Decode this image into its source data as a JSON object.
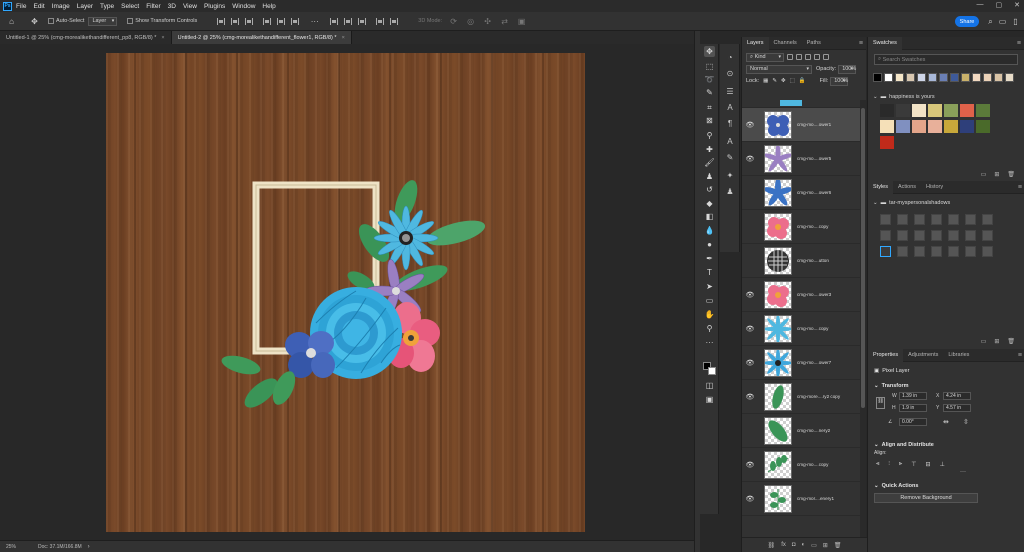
{
  "menubar": {
    "logo": "Ps",
    "items": [
      "File",
      "Edit",
      "Image",
      "Layer",
      "Type",
      "Select",
      "Filter",
      "3D",
      "View",
      "Plugins",
      "Window",
      "Help"
    ]
  },
  "options": {
    "auto_select_label": "Auto-Select",
    "auto_select_target": "Layer",
    "transform_label": "Show Transform Controls",
    "mode_3d": "3D Mode:",
    "share_label": "Share"
  },
  "tabs": [
    {
      "label": "Untitled-1 @ 25% (cmg-morealikethandifferent_pp8, RGB/8) *",
      "active": false
    },
    {
      "label": "Untitled-2 @ 25% (cmg-morealikethandifferent_flower1, RGB/8) *",
      "active": true
    }
  ],
  "status": {
    "zoom": "25%",
    "doc": "Doc: 37.1M/166.8M"
  },
  "layers_panel": {
    "tabs": [
      "Layers",
      "Channels",
      "Paths"
    ],
    "kind_label": "Kind",
    "blend_mode": "Normal",
    "opacity_label": "Opacity:",
    "opacity_value": "100%",
    "lock_label": "Lock:",
    "fill_label": "Fill:",
    "fill_value": "100%",
    "layers": [
      {
        "name": "cmg-mo....ower1",
        "visible": true,
        "selected": true
      },
      {
        "name": "cmg-mo....ower5",
        "visible": true,
        "selected": false
      },
      {
        "name": "cmg-mo....ower6",
        "visible": false,
        "selected": false
      },
      {
        "name": "cmg-mo....copy",
        "visible": false,
        "selected": false
      },
      {
        "name": "cmg-mo....utton",
        "visible": false,
        "selected": false
      },
      {
        "name": "cmg-mo....ower3",
        "visible": true,
        "selected": false
      },
      {
        "name": "cmg-mo....copy",
        "visible": true,
        "selected": false
      },
      {
        "name": "cmg-mo....ower7",
        "visible": true,
        "selected": false
      },
      {
        "name": "cmg-more....ry2 copy",
        "visible": true,
        "selected": false
      },
      {
        "name": "cmg-mo....nery2",
        "visible": false,
        "selected": false
      },
      {
        "name": "cmg-mo....copy",
        "visible": true,
        "selected": false
      },
      {
        "name": "cmg-mor....enery1",
        "visible": true,
        "selected": false
      }
    ]
  },
  "swatches": {
    "tab": "Swatches",
    "search_placeholder": "Search Swatches",
    "recent": [
      "#000000",
      "#ffffff",
      "#f5e6c8",
      "#d8c7b0",
      "#cfd6e8",
      "#a8b8d8",
      "#6a7fb5",
      "#3e5a9a",
      "#c9b16a",
      "#f2d9c0",
      "#ecd2b8",
      "#d9c3a5",
      "#e8dcc8"
    ],
    "folder_name": "happiness is yours",
    "group": [
      "#2a2a2a",
      "#3a3a3a",
      "#f2e3c6",
      "#d8c77a",
      "#8aa05a",
      "#e0624a",
      "#5b7a3a",
      "#f5e0b8",
      "#8090c0",
      "#e3a58a",
      "#e8b09a",
      "#c8a83a",
      "#2e3f7a",
      "#4a6a2a",
      "#c02a1a"
    ]
  },
  "styles": {
    "tabs": [
      "Styles",
      "Actions",
      "History"
    ],
    "folder_name": "tar-myspersonalshadows"
  },
  "properties": {
    "tabs": [
      "Properties",
      "Adjustments",
      "Libraries"
    ],
    "layer_type": "Pixel Layer",
    "transform_label": "Transform",
    "w_label": "W",
    "w_value": "1.39 in",
    "h_label": "H",
    "h_value": "1.9 in",
    "x_label": "X",
    "x_value": "4.24 in",
    "y_label": "Y",
    "y_value": "4.57 in",
    "angle_value": "0.00°",
    "align_label": "Align and Distribute",
    "align_sub": "Align:",
    "quick_actions_label": "Quick Actions",
    "remove_bg_label": "Remove Background"
  },
  "icons": {
    "home": "home-icon",
    "move": "move-icon",
    "search": "search-icon",
    "eye": "eye-icon"
  }
}
